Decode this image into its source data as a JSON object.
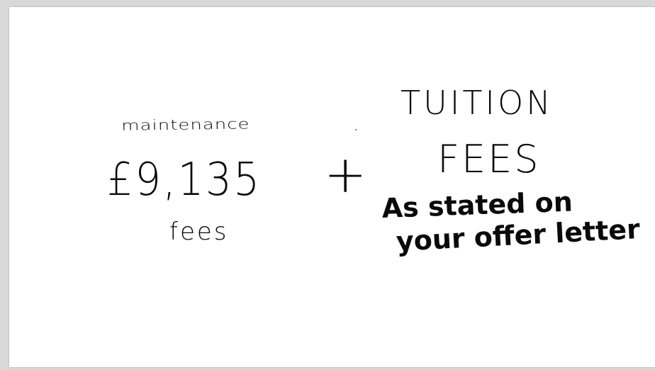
{
  "note": {
    "left": {
      "label_top": "maintenance",
      "amount": "£9,135",
      "label_bottom": "fees"
    },
    "operator": "+",
    "right": {
      "line1": "TUITION",
      "line2": "FEES",
      "line3": "As stated on",
      "line4": "your offer letter"
    }
  }
}
